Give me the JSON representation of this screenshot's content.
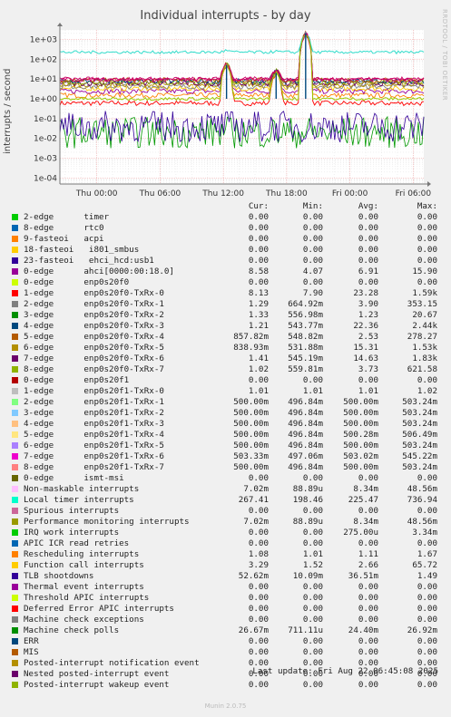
{
  "title": "Individual interrupts - by day",
  "ylabel": "interrupts / second",
  "vendor": "RRDTOOL / TOBI OETIKER",
  "columns": [
    "Cur:",
    "Min:",
    "Avg:",
    "Max:"
  ],
  "last_update": "Last update: Fri Aug 22 06:45:08 2025",
  "footer": "Munin 2.0.75",
  "chart_data": {
    "type": "line",
    "title": "Individual interrupts - by day",
    "ylabel": "interrupts / second",
    "yscale": "log",
    "ylim": [
      5e-05,
      3000
    ],
    "yticks": [
      {
        "value": 1000,
        "label": "1e+03"
      },
      {
        "value": 100,
        "label": "1e+02"
      },
      {
        "value": 10,
        "label": "1e+01"
      },
      {
        "value": 1,
        "label": "1e+00"
      },
      {
        "value": 0.1,
        "label": "1e-01"
      },
      {
        "value": 0.01,
        "label": "1e-02"
      },
      {
        "value": 0.001,
        "label": "1e-03"
      },
      {
        "value": 0.0001,
        "label": "1e-04"
      }
    ],
    "xlim": [
      -3.5,
      31
    ],
    "xticks": [
      {
        "value": 0,
        "label": "Thu 00:00"
      },
      {
        "value": 6,
        "label": "Thu 06:00"
      },
      {
        "value": 12,
        "label": "Thu 12:00"
      },
      {
        "value": 18,
        "label": "Thu 18:00"
      },
      {
        "value": 24,
        "label": "Fri 00:00"
      },
      {
        "value": 30,
        "label": "Fri 06:00"
      }
    ],
    "grid": true,
    "series_levels": [
      {
        "name": "Local timer interrupts",
        "color": "#33ddcc",
        "level": 225
      },
      {
        "name": "8-edge enp0s20f1-TxRx-7",
        "color": "#cc0066",
        "level": 10
      },
      {
        "name": "Machine check polls",
        "color": "#009900",
        "level": 0.02
      },
      {
        "name": "TLB shootdowns",
        "color": "#330099",
        "level": 0.04
      },
      {
        "name": "Posted-interrupt wakeup event",
        "color": "#99cc00",
        "level": 1
      }
    ],
    "spikes": [
      {
        "x": 12.3,
        "peak": 50
      },
      {
        "x": 17.0,
        "peak": 20
      },
      {
        "x": 19.8,
        "peak": 2000
      }
    ]
  },
  "legend": [
    {
      "label": "2-edge      timer",
      "color": "#00cc00",
      "cur": "0.00",
      "min": "0.00",
      "avg": "0.00",
      "max": "0.00"
    },
    {
      "label": "8-edge      rtc0",
      "color": "#0066b3",
      "cur": "0.00",
      "min": "0.00",
      "avg": "0.00",
      "max": "0.00"
    },
    {
      "label": "9-fasteoi   acpi",
      "color": "#ff8000",
      "cur": "0.00",
      "min": "0.00",
      "avg": "0.00",
      "max": "0.00"
    },
    {
      "label": "18-fasteoi   i801_smbus",
      "color": "#ffcc00",
      "cur": "0.00",
      "min": "0.00",
      "avg": "0.00",
      "max": "0.00"
    },
    {
      "label": "23-fasteoi   ehci_hcd:usb1",
      "color": "#330099",
      "cur": "0.00",
      "min": "0.00",
      "avg": "0.00",
      "max": "0.00"
    },
    {
      "label": "0-edge      ahci[0000:00:18.0]",
      "color": "#990099",
      "cur": "8.58",
      "min": "4.07",
      "avg": "6.91",
      "max": "15.90"
    },
    {
      "label": "0-edge      enp0s20f0",
      "color": "#ccff00",
      "cur": "0.00",
      "min": "0.00",
      "avg": "0.00",
      "max": "0.00"
    },
    {
      "label": "1-edge      enp0s20f0-TxRx-0",
      "color": "#ff0000",
      "cur": "8.13",
      "min": "7.90",
      "avg": "23.28",
      "max": "1.59k"
    },
    {
      "label": "2-edge      enp0s20f0-TxRx-1",
      "color": "#808080",
      "cur": "1.29",
      "min": "664.92m",
      "avg": "3.90",
      "max": "353.15"
    },
    {
      "label": "3-edge      enp0s20f0-TxRx-2",
      "color": "#008f00",
      "cur": "1.33",
      "min": "556.98m",
      "avg": "1.23",
      "max": "20.67"
    },
    {
      "label": "4-edge      enp0s20f0-TxRx-3",
      "color": "#00487d",
      "cur": "1.21",
      "min": "543.77m",
      "avg": "22.36",
      "max": "2.44k"
    },
    {
      "label": "5-edge      enp0s20f0-TxRx-4",
      "color": "#b35a00",
      "cur": "857.82m",
      "min": "548.82m",
      "avg": "2.53",
      "max": "278.27"
    },
    {
      "label": "6-edge      enp0s20f0-TxRx-5",
      "color": "#b38f00",
      "cur": "838.93m",
      "min": "531.88m",
      "avg": "15.31",
      "max": "1.53k"
    },
    {
      "label": "7-edge      enp0s20f0-TxRx-6",
      "color": "#6b006b",
      "cur": "1.41",
      "min": "545.19m",
      "avg": "14.63",
      "max": "1.83k"
    },
    {
      "label": "8-edge      enp0s20f0-TxRx-7",
      "color": "#8fb300",
      "cur": "1.02",
      "min": "559.81m",
      "avg": "3.73",
      "max": "621.58"
    },
    {
      "label": "0-edge      enp0s20f1",
      "color": "#b30000",
      "cur": "0.00",
      "min": "0.00",
      "avg": "0.00",
      "max": "0.00"
    },
    {
      "label": "1-edge      enp0s20f1-TxRx-0",
      "color": "#bebebe",
      "cur": "1.01",
      "min": "1.01",
      "avg": "1.01",
      "max": "1.02"
    },
    {
      "label": "2-edge      enp0s20f1-TxRx-1",
      "color": "#80ff80",
      "cur": "500.00m",
      "min": "496.84m",
      "avg": "500.00m",
      "max": "503.24m"
    },
    {
      "label": "3-edge      enp0s20f1-TxRx-2",
      "color": "#80c9ff",
      "cur": "500.00m",
      "min": "496.84m",
      "avg": "500.00m",
      "max": "503.24m"
    },
    {
      "label": "4-edge      enp0s20f1-TxRx-3",
      "color": "#ffc080",
      "cur": "500.00m",
      "min": "496.84m",
      "avg": "500.00m",
      "max": "503.24m"
    },
    {
      "label": "5-edge      enp0s20f1-TxRx-4",
      "color": "#ffe680",
      "cur": "500.00m",
      "min": "496.84m",
      "avg": "500.28m",
      "max": "506.49m"
    },
    {
      "label": "6-edge      enp0s20f1-TxRx-5",
      "color": "#aa80ff",
      "cur": "500.00m",
      "min": "496.84m",
      "avg": "500.00m",
      "max": "503.24m"
    },
    {
      "label": "7-edge      enp0s20f1-TxRx-6",
      "color": "#ee00cc",
      "cur": "503.33m",
      "min": "497.06m",
      "avg": "503.02m",
      "max": "545.22m"
    },
    {
      "label": "8-edge      enp0s20f1-TxRx-7",
      "color": "#ff8080",
      "cur": "500.00m",
      "min": "496.84m",
      "avg": "500.00m",
      "max": "503.24m"
    },
    {
      "label": "0-edge      ismt-msi",
      "color": "#666600",
      "cur": "0.00",
      "min": "0.00",
      "avg": "0.00",
      "max": "0.00"
    },
    {
      "label": "Non-maskable interrupts",
      "color": "#ffbfff",
      "cur": "7.02m",
      "min": "88.89u",
      "avg": "8.34m",
      "max": "48.56m"
    },
    {
      "label": "Local timer interrupts",
      "color": "#00ffcc",
      "cur": "267.41",
      "min": "198.46",
      "avg": "225.47",
      "max": "736.94"
    },
    {
      "label": "Spurious interrupts",
      "color": "#cc6699",
      "cur": "0.00",
      "min": "0.00",
      "avg": "0.00",
      "max": "0.00"
    },
    {
      "label": "Performance monitoring interrupts",
      "color": "#999900",
      "cur": "7.02m",
      "min": "88.89u",
      "avg": "8.34m",
      "max": "48.56m"
    },
    {
      "label": "IRQ work interrupts",
      "color": "#00cc00",
      "cur": "0.00",
      "min": "0.00",
      "avg": "275.00u",
      "max": "3.34m"
    },
    {
      "label": "APIC ICR read retries",
      "color": "#0066b3",
      "cur": "0.00",
      "min": "0.00",
      "avg": "0.00",
      "max": "0.00"
    },
    {
      "label": "Rescheduling interrupts",
      "color": "#ff8000",
      "cur": "1.08",
      "min": "1.01",
      "avg": "1.11",
      "max": "1.67"
    },
    {
      "label": "Function call interrupts",
      "color": "#ffcc00",
      "cur": "3.29",
      "min": "1.52",
      "avg": "2.66",
      "max": "65.72"
    },
    {
      "label": "TLB shootdowns",
      "color": "#330099",
      "cur": "52.62m",
      "min": "10.09m",
      "avg": "36.51m",
      "max": "1.49"
    },
    {
      "label": "Thermal event interrupts",
      "color": "#990099",
      "cur": "0.00",
      "min": "0.00",
      "avg": "0.00",
      "max": "0.00"
    },
    {
      "label": "Threshold APIC interrupts",
      "color": "#ccff00",
      "cur": "0.00",
      "min": "0.00",
      "avg": "0.00",
      "max": "0.00"
    },
    {
      "label": "Deferred Error APIC interrupts",
      "color": "#ff0000",
      "cur": "0.00",
      "min": "0.00",
      "avg": "0.00",
      "max": "0.00"
    },
    {
      "label": "Machine check exceptions",
      "color": "#808080",
      "cur": "0.00",
      "min": "0.00",
      "avg": "0.00",
      "max": "0.00"
    },
    {
      "label": "Machine check polls",
      "color": "#008f00",
      "cur": "26.67m",
      "min": "711.11u",
      "avg": "24.40m",
      "max": "26.92m"
    },
    {
      "label": "ERR",
      "color": "#00487d",
      "cur": "0.00",
      "min": "0.00",
      "avg": "0.00",
      "max": "0.00"
    },
    {
      "label": "MIS",
      "color": "#b35a00",
      "cur": "0.00",
      "min": "0.00",
      "avg": "0.00",
      "max": "0.00"
    },
    {
      "label": "Posted-interrupt notification event",
      "color": "#b38f00",
      "cur": "0.00",
      "min": "0.00",
      "avg": "0.00",
      "max": "0.00"
    },
    {
      "label": "Nested posted-interrupt event",
      "color": "#6b006b",
      "cur": "0.00",
      "min": "0.00",
      "avg": "0.00",
      "max": "0.00"
    },
    {
      "label": "Posted-interrupt wakeup event",
      "color": "#8fb300",
      "cur": "0.00",
      "min": "0.00",
      "avg": "0.00",
      "max": "0.00"
    }
  ]
}
